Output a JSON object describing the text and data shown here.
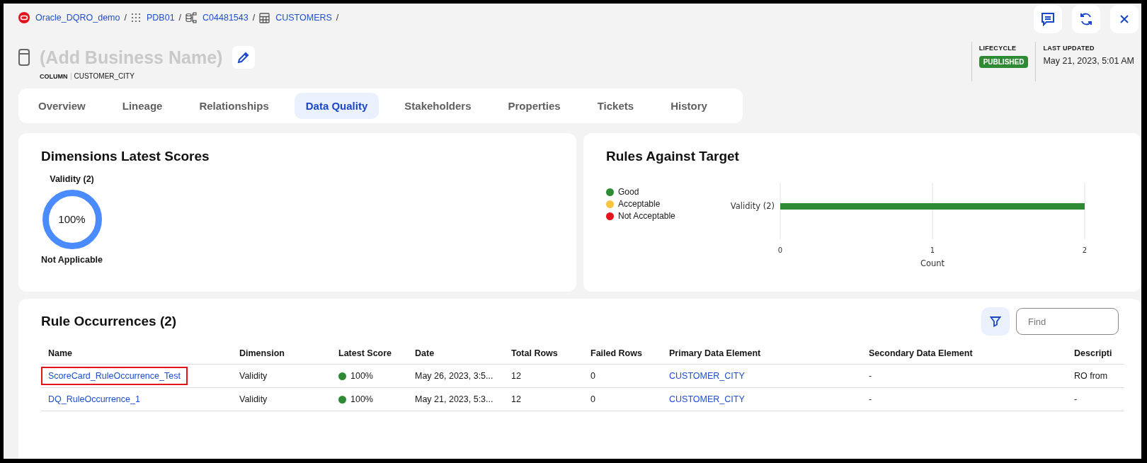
{
  "breadcrumb": [
    {
      "label": "Oracle_DQRO_demo",
      "kind": "oracle"
    },
    {
      "label": "PDB01",
      "kind": "grid"
    },
    {
      "label": "C04481543",
      "kind": "schema"
    },
    {
      "label": "CUSTOMERS",
      "kind": "table"
    }
  ],
  "breadcrumb_separator": "/",
  "header": {
    "title": "(Add Business Name)",
    "type_label": "COLUMN",
    "type_value": "CUSTOMER_CITY",
    "lifecycle_label": "LIFECYCLE",
    "lifecycle_value": "PUBLISHED",
    "updated_label": "LAST UPDATED",
    "updated_value": "May 21, 2023, 5:01 AM"
  },
  "tabs": [
    {
      "label": "Overview",
      "selected": false
    },
    {
      "label": "Lineage",
      "selected": false
    },
    {
      "label": "Relationships",
      "selected": false
    },
    {
      "label": "Data Quality",
      "selected": true
    },
    {
      "label": "Stakeholders",
      "selected": false
    },
    {
      "label": "Properties",
      "selected": false
    },
    {
      "label": "Tickets",
      "selected": false
    },
    {
      "label": "History",
      "selected": false
    }
  ],
  "dimensions": {
    "title": "Dimensions Latest Scores",
    "items": [
      {
        "name": "Validity (2)",
        "score": "100%",
        "level": 1,
        "status": "Not Applicable"
      }
    ]
  },
  "rules_against_target": {
    "title": "Rules Against Target",
    "chart_data": {
      "type": "bar",
      "orientation": "horizontal",
      "xlabel": "Count",
      "categories": [
        "Validity (2)"
      ],
      "series": [
        {
          "name": "Good",
          "color": "#2e8b33",
          "values": [
            2
          ]
        },
        {
          "name": "Acceptable",
          "color": "#f9c440",
          "values": [
            0
          ]
        },
        {
          "name": "Not Acceptable",
          "color": "#e3131b",
          "values": [
            0
          ]
        }
      ],
      "xlim": [
        0,
        2
      ],
      "xticks": [
        0,
        1,
        2
      ]
    }
  },
  "rule_occurrences": {
    "title": "Rule Occurrences (2)",
    "search": {
      "placeholder": "Find"
    },
    "columns": [
      "Name",
      "Dimension",
      "Latest Score",
      "Date",
      "Total Rows",
      "Failed Rows",
      "Primary Data Element",
      "Secondary Data Element",
      "Descripti"
    ],
    "rows": [
      {
        "highlighted": true,
        "cells": [
          "ScoreCard_RuleOccurrence_Test",
          "Validity",
          "100%",
          "May 26, 2023, 3:5...",
          "12",
          "0",
          "CUSTOMER_CITY",
          "-",
          "RO from"
        ]
      },
      {
        "highlighted": false,
        "cells": [
          "DQ_RuleOccurrence_1",
          "Validity",
          "100%",
          "May 21, 2023, 5:3...",
          "12",
          "0",
          "CUSTOMER_CITY",
          "-",
          "-"
        ]
      }
    ]
  }
}
